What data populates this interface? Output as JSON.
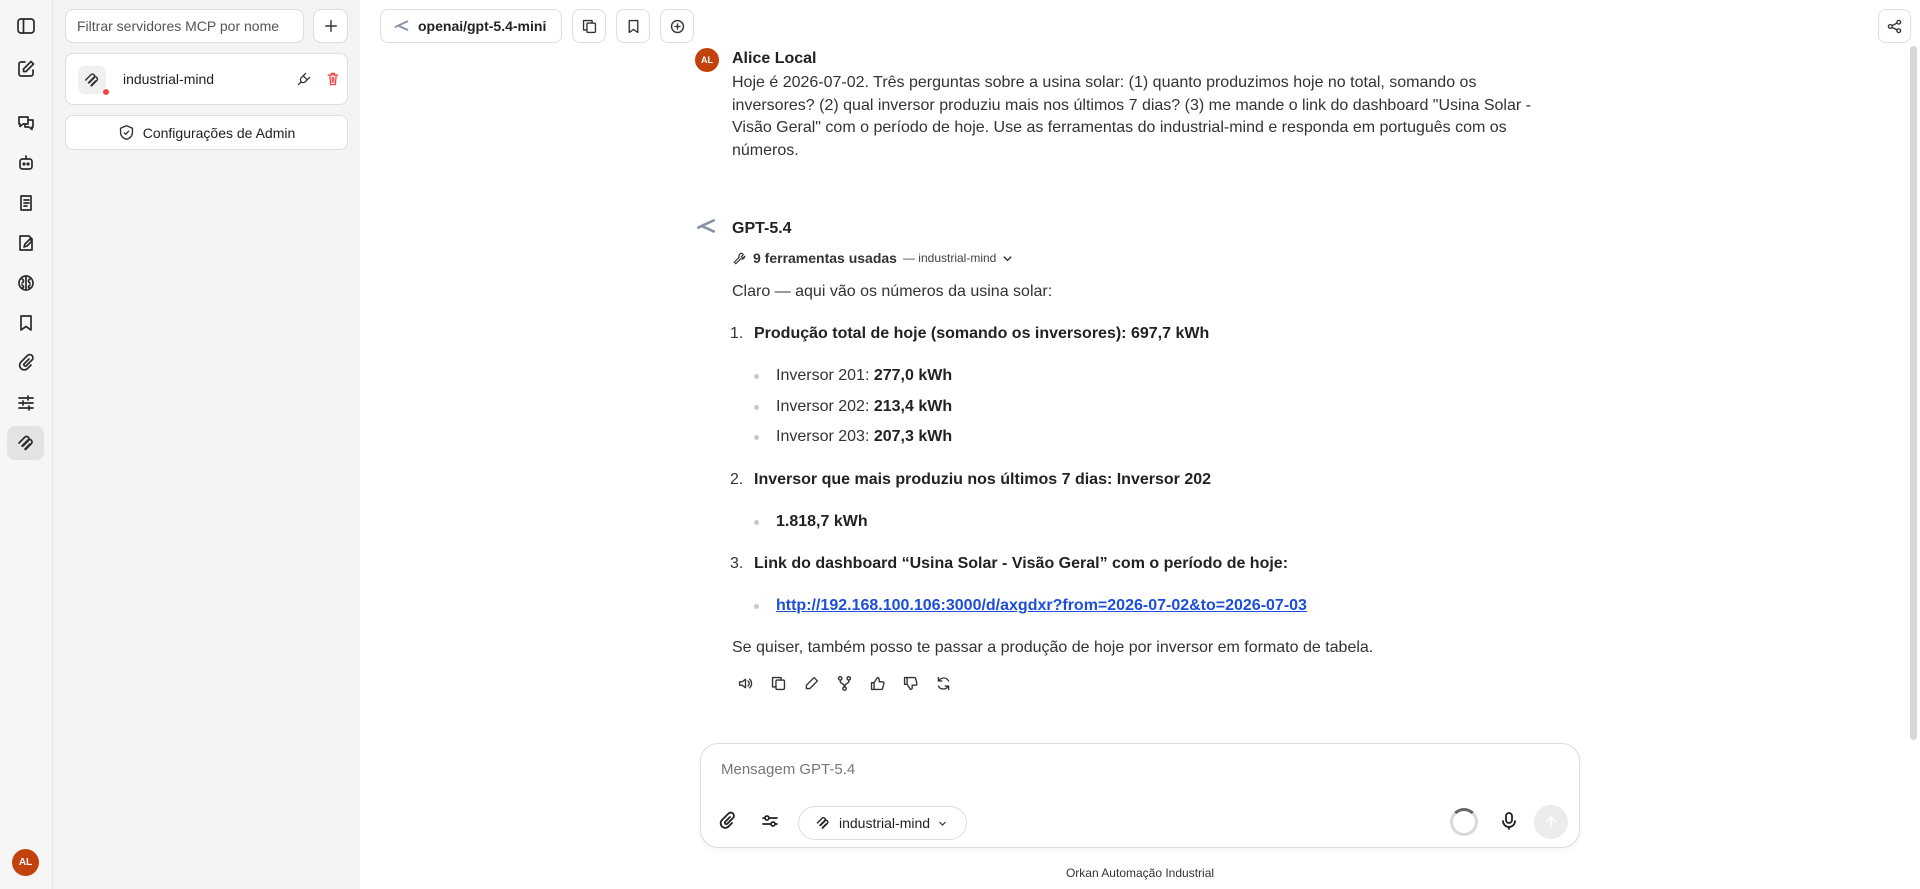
{
  "sidebar": {
    "icons": [
      "sidebar-toggle-icon",
      "new-chat-icon",
      "chats-icon",
      "bot-icon",
      "notes-icon",
      "prompts-icon",
      "brain-icon",
      "bookmark-icon",
      "attachment-icon",
      "sliders-icon",
      "mcp-icon"
    ],
    "user_initials": "AL"
  },
  "mcp_panel": {
    "filter_placeholder": "Filtrar servidores MCP por nome",
    "servers": [
      {
        "name": "industrial-mind",
        "status": "error"
      }
    ],
    "admin_label": "Configurações de Admin"
  },
  "topbar": {
    "model": "openai/gpt-5.4-mini"
  },
  "chat": {
    "user": {
      "initials": "AL",
      "name": "Alice Local",
      "text": "Hoje é 2026-07-02. Três perguntas sobre a usina solar: (1) quanto produzimos hoje no total, somando os inversores? (2) qual inversor produziu mais nos últimos 7 dias? (3) me mande o link do dashboard \"Usina Solar - Visão Geral\" com o período de hoje. Use as ferramentas do industrial-mind e responda em português com os números."
    },
    "assistant": {
      "name": "GPT-5.4",
      "tools_count": "9 ferramentas usadas",
      "tools_server": "— industrial-mind",
      "intro": "Claro — aqui vão os números da usina solar:",
      "items": [
        {
          "num": "1.",
          "title": "Produção total de hoje (somando os inversores): 697,7 kWh",
          "subs": [
            {
              "label": "Inversor 201: ",
              "value": "277,0 kWh"
            },
            {
              "label": "Inversor 202: ",
              "value": "213,4 kWh"
            },
            {
              "label": "Inversor 203: ",
              "value": "207,3 kWh"
            }
          ]
        },
        {
          "num": "2.",
          "title": "Inversor que mais produziu nos últimos 7 dias: Inversor 202",
          "subs": [
            {
              "label": "",
              "value": "1.818,7 kWh"
            }
          ]
        },
        {
          "num": "3.",
          "title": "Link do dashboard “Usina Solar - Visão Geral” com o período de hoje:",
          "link": "http://192.168.100.106:3000/d/axgdxr?from=2026-07-02&to=2026-07-03"
        }
      ],
      "outro": "Se quiser, também posso te passar a produção de hoje por inversor em formato de tabela."
    }
  },
  "composer": {
    "placeholder": "Mensagem GPT-5.4",
    "server_chip": "industrial-mind"
  },
  "footer": "Orkan Automação Industrial"
}
